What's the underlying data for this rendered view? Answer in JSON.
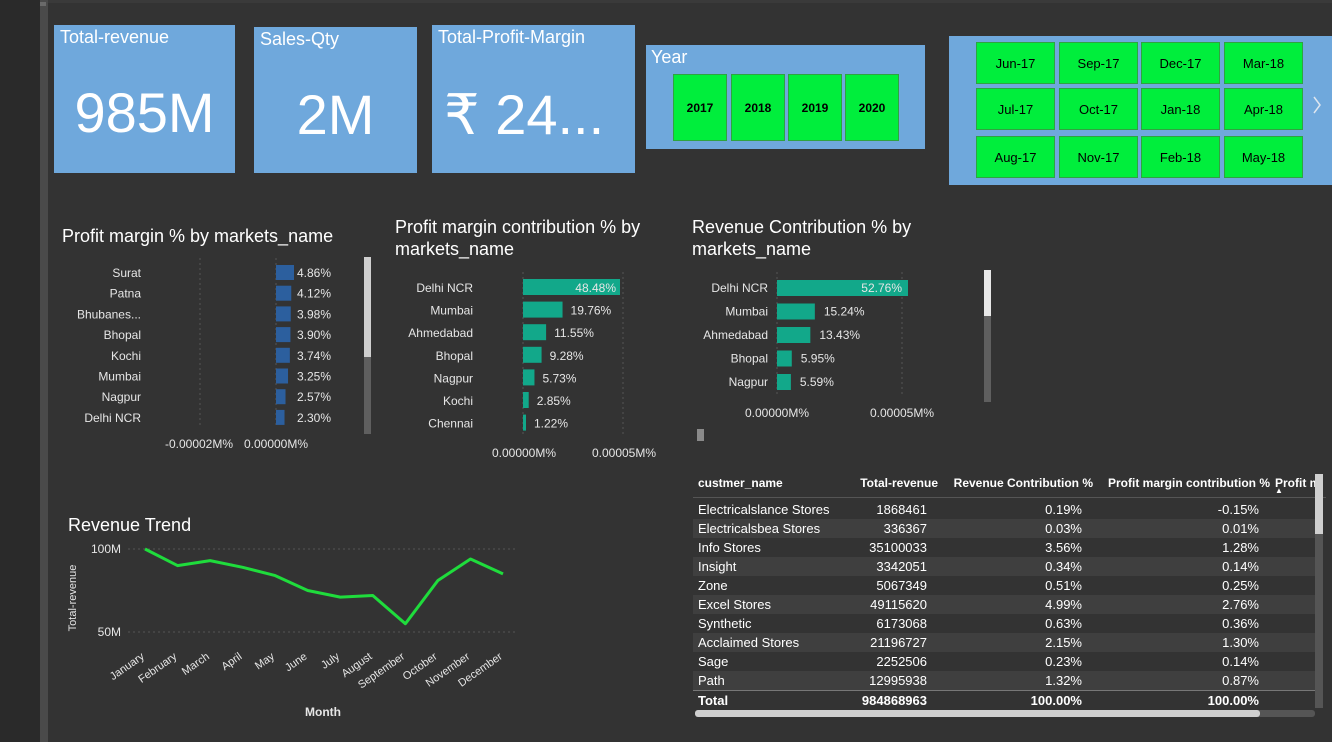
{
  "kpis": {
    "revenue": {
      "title": "Total-revenue",
      "value": "985M"
    },
    "qty": {
      "title": "Sales-Qty",
      "value": "2M"
    },
    "margin": {
      "title": "Total-Profit-Margin",
      "value": "₹ 24..."
    }
  },
  "year_slicer": {
    "title": "Year",
    "years": [
      "2017",
      "2018",
      "2019",
      "2020"
    ]
  },
  "month_slicer": {
    "months": [
      "Jun-17",
      "Sep-17",
      "Dec-17",
      "Mar-18",
      "Jul-17",
      "Oct-17",
      "Jan-18",
      "Apr-18",
      "Aug-17",
      "Nov-17",
      "Feb-18",
      "May-18"
    ],
    "next_icon": "chevron-right-icon"
  },
  "chart_titles": {
    "pm": "Profit margin % by markets_name",
    "pmc": "Profit margin contribution % by markets_name",
    "rc": "Revenue Contribution % by markets_name",
    "trend": "Revenue Trend"
  },
  "chart_data": [
    {
      "type": "bar",
      "orientation": "horizontal",
      "title": "Profit margin % by markets_name",
      "categories": [
        "Surat",
        "Patna",
        "Bhubanes...",
        "Bhopal",
        "Kochi",
        "Mumbai",
        "Nagpur",
        "Delhi NCR"
      ],
      "values": [
        4.86,
        4.12,
        3.98,
        3.9,
        3.74,
        3.25,
        2.57,
        2.3
      ],
      "labels": [
        "4.86%",
        "4.12%",
        "3.98%",
        "3.90%",
        "3.74%",
        "3.25%",
        "2.57%",
        "2.30%"
      ],
      "x_ticks": [
        "-0.00002M%",
        "0.00000M%"
      ],
      "color": "#2c5f9e"
    },
    {
      "type": "bar",
      "orientation": "horizontal",
      "title": "Profit margin contribution % by markets_name",
      "categories": [
        "Delhi NCR",
        "Mumbai",
        "Ahmedabad",
        "Bhopal",
        "Nagpur",
        "Kochi",
        "Chennai"
      ],
      "values": [
        48.48,
        19.76,
        11.55,
        9.28,
        5.73,
        2.85,
        1.22
      ],
      "labels": [
        "48.48%",
        "19.76%",
        "11.55%",
        "9.28%",
        "5.73%",
        "2.85%",
        "1.22%"
      ],
      "x_ticks": [
        "0.00000M%",
        "0.00005M%"
      ],
      "color": "#12a88a"
    },
    {
      "type": "bar",
      "orientation": "horizontal",
      "title": "Revenue Contribution % by markets_name",
      "categories": [
        "Delhi NCR",
        "Mumbai",
        "Ahmedabad",
        "Bhopal",
        "Nagpur"
      ],
      "values": [
        52.76,
        15.24,
        13.43,
        5.95,
        5.59
      ],
      "labels": [
        "52.76%",
        "15.24%",
        "13.43%",
        "5.95%",
        "5.59%"
      ],
      "x_ticks": [
        "0.00000M%",
        "0.00005M%"
      ],
      "color": "#12a88a"
    },
    {
      "type": "line",
      "title": "Revenue Trend",
      "x": [
        "January",
        "February",
        "March",
        "April",
        "May",
        "June",
        "July",
        "August",
        "September",
        "October",
        "November",
        "December"
      ],
      "values": [
        100,
        90,
        93,
        89,
        84,
        75,
        71,
        72,
        55,
        81,
        94,
        85
      ],
      "y_ticks": [
        "100M",
        "50M"
      ],
      "ylim": [
        40,
        105
      ],
      "xlabel": "Month",
      "ylabel": "Total-revenue",
      "color": "#1fdc3c"
    }
  ],
  "table": {
    "headers": [
      "custmer_name",
      "Total-revenue",
      "Revenue Contribution %",
      "Profit margin contribution %",
      "Profit m"
    ],
    "rows": [
      [
        "Electricalslance Stores",
        "1868461",
        "0.19%",
        "-0.15%"
      ],
      [
        "Electricalsbea Stores",
        "336367",
        "0.03%",
        "0.01%"
      ],
      [
        "Info Stores",
        "35100033",
        "3.56%",
        "1.28%"
      ],
      [
        "Insight",
        "3342051",
        "0.34%",
        "0.14%"
      ],
      [
        "Zone",
        "5067349",
        "0.51%",
        "0.25%"
      ],
      [
        "Excel Stores",
        "49115620",
        "4.99%",
        "2.76%"
      ],
      [
        "Synthetic",
        "6173068",
        "0.63%",
        "0.36%"
      ],
      [
        "Acclaimed Stores",
        "21196727",
        "2.15%",
        "1.30%"
      ],
      [
        "Sage",
        "2252506",
        "0.23%",
        "0.14%"
      ],
      [
        "Path",
        "12995938",
        "1.32%",
        "0.87%"
      ]
    ],
    "total": [
      "Total",
      "984868963",
      "100.00%",
      "100.00%"
    ]
  }
}
